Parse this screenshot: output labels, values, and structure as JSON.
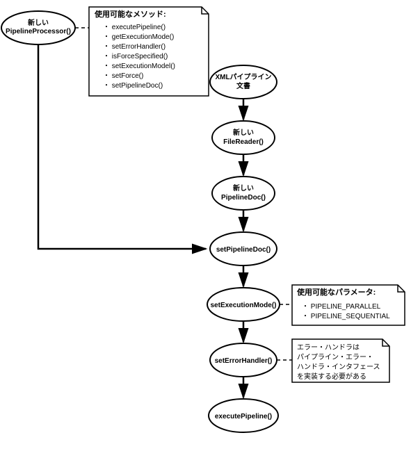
{
  "nodes": {
    "pipelineProcessor": {
      "line1": "新しい",
      "line2": "PipelineProcessor()"
    },
    "xmlDoc": {
      "line1": "XMLパイプライン",
      "line2": "文書"
    },
    "fileReader": {
      "line1": "新しい",
      "line2": "FileReader()"
    },
    "pipelineDoc": {
      "line1": "新しい",
      "line2": "PipelineDoc()"
    },
    "setPipelineDoc": {
      "line1": "setPipelineDoc()"
    },
    "setExecutionMode": {
      "line1": "setExecutionMode()"
    },
    "setErrorHandler": {
      "line1": "setErrorHandler()"
    },
    "executePipeline": {
      "line1": "executePipeline()"
    }
  },
  "notes": {
    "methods": {
      "title": "使用可能なメソッド:",
      "items": [
        "executePipeline()",
        "getExecutionMode()",
        "setErrorHandler()",
        "isForceSpecified()",
        "setExecutionModel()",
        "setForce()",
        "setPipelineDoc()"
      ]
    },
    "params": {
      "title": "使用可能なパラメータ:",
      "items": [
        "PIPELINE_PARALLEL",
        "PIPELINE_SEQUENTIAL"
      ]
    },
    "errorHandler": {
      "lines": [
        "エラー・ハンドラは",
        "パイプライン・エラー・",
        "ハンドラ・インタフェース",
        "を実装する必要がある"
      ]
    }
  }
}
